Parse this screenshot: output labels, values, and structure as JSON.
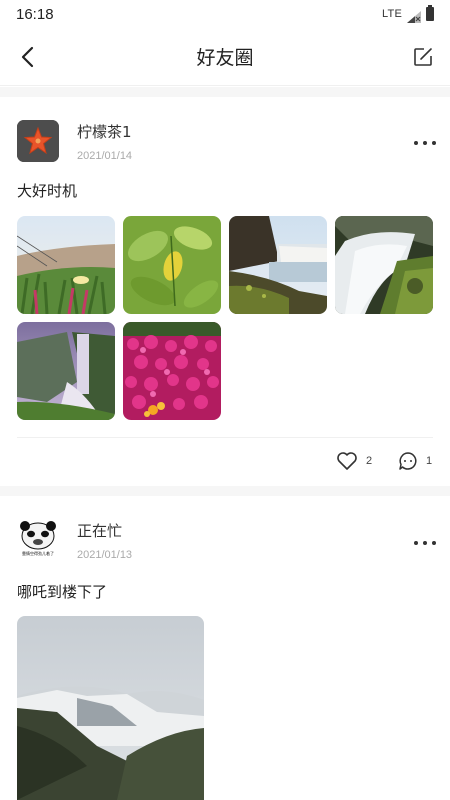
{
  "status_bar": {
    "time": "16:18",
    "network": "LTE"
  },
  "header": {
    "title": "好友圈"
  },
  "posts": [
    {
      "name": "柠檬茶1",
      "date": "2021/01/14",
      "text": "大好时机",
      "avatar_icon": "starfish-icon",
      "images": [
        "flower-field",
        "green-leaves",
        "waterfall-lake",
        "waterfall-rocks",
        "waterfall-cliff",
        "pink-flowers"
      ],
      "likes": "2",
      "comments": "1"
    },
    {
      "name": "正在忙",
      "date": "2021/01/13",
      "text": "哪吒到楼下了",
      "avatar_icon": "panda-meme-icon",
      "avatar_caption": "靠情空得劲儿着了",
      "images": [
        "snowy-mountain"
      ]
    }
  ],
  "colors": {
    "divider": "#f0f0f0",
    "date": "#aaaaaa",
    "gap": "#f6f6f6"
  }
}
